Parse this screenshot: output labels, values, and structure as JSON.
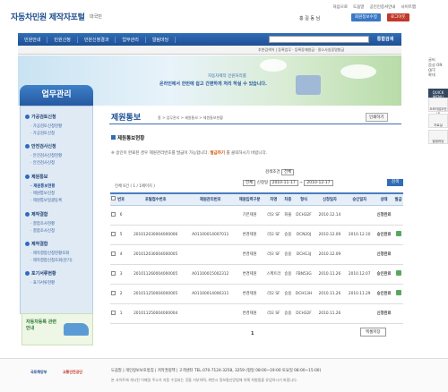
{
  "header": {
    "logo": "자동차민원 제작자포털",
    "logo_sub": "대국민",
    "util": [
      "처음으로",
      "도움말",
      "공인인증서안내",
      "사이트맵"
    ],
    "greeting": "홍 길 동 님",
    "edit_btn": "회원정보수정",
    "logout_btn": "로그아웃"
  },
  "nav": {
    "items": [
      "민원안내",
      "민원신청",
      "민원신청결과",
      "업무관리",
      "알림마당"
    ],
    "search_btn": "통합검색"
  },
  "subbar": {
    "text": "추천검색어 | 등록업무 · 등록증재발급 · 말소사실증명발급"
  },
  "banner": {
    "line1": "자동차제작 민원처리를",
    "line2": "온라인에서 한번에 쉽고 간편하게 처리 하실 수 있습니다."
  },
  "sidebar": {
    "title": "업무관리",
    "sections": [
      {
        "label": "가공검토신청",
        "items": [
          "가공검토신청현황",
          "가공검토신청"
        ]
      },
      {
        "label": "안전검사신청",
        "items": [
          "안전검사신청현황",
          "안전검사신청"
        ]
      },
      {
        "label": "제원통보",
        "items": [
          "제원통보현황",
          "제원통보신청",
          "제원통보일괄등록"
        ]
      },
      {
        "label": "제작결함",
        "items": [
          "결함조사현황",
          "결함조사신청"
        ]
      },
      {
        "label": "제작결합",
        "items": [
          "제작결합신청현황조회",
          "제작결합신청조회(분기)"
        ]
      },
      {
        "label": "포기서류현황",
        "items": [
          "표기서류현황"
        ]
      }
    ],
    "ad": "자동차등록 관련 안내"
  },
  "main": {
    "title": "제원통보",
    "crumb": "홈 > 업무관리 > 제원통보 > 제원통보현황",
    "print": "인쇄하기",
    "subtitle": "제원통보현황",
    "notice_pre": "※ 승인이 완료된 경우 제원관리번호를 발급이 가능합니다.",
    "notice_em": "발급하기",
    "notice_post": "를 클릭하시기 바랍니다.",
    "filter_label": "검색조건",
    "filter_value": "전체",
    "filter_status": "전체",
    "date_label": "신청일",
    "date_from": "2010-11-17",
    "date_to": "2010-12-17",
    "search": "검색",
    "count": "전체 6건 ( 1 / 1페이지 )",
    "columns": [
      "번호",
      "포털접수번호",
      "제원관리번호",
      "제원입력구분",
      "차명",
      "차종",
      "형식",
      "신청일자",
      "승인일자",
      "상태",
      "발급"
    ],
    "rows": [
      {
        "no": "6",
        "portal": "",
        "spec": "",
        "type": "기본제원",
        "car": "리오 SF",
        "kind": "화물",
        "form": "DCH32F",
        "req": "2010.12.14",
        "ok": "",
        "status": "신청완료",
        "issue": false
      },
      {
        "no": "5",
        "portal": "201012030004000006",
        "spec": "A01100014007011",
        "type": "변경제원",
        "car": "리오 SF",
        "kind": "승용",
        "form": "DCN20J",
        "req": "2010.12.09",
        "ok": "2010.12.10",
        "status": "승인완료",
        "issue": true
      },
      {
        "no": "4",
        "portal": "201012030004000005",
        "spec": "",
        "type": "변경제원",
        "car": "리오 SF",
        "kind": "승용",
        "form": "DCH13J",
        "req": "2010.12.09",
        "ok": "",
        "status": "신청완료",
        "issue": false
      },
      {
        "no": "3",
        "portal": "201011260004000005",
        "spec": "A01100015002312",
        "type": "변경제원",
        "car": "스펙트라",
        "kind": "승용",
        "form": "FBN53G",
        "req": "2010.11.26",
        "ok": "2010.12.07",
        "status": "승인완료",
        "issue": true
      },
      {
        "no": "2",
        "portal": "201011250004000005",
        "spec": "A01100014006311",
        "type": "변경제원",
        "car": "리오 SF",
        "kind": "승용",
        "form": "DCH13H",
        "req": "2010.11.26",
        "ok": "2010.11.29",
        "status": "승인완료",
        "issue": true
      },
      {
        "no": "1",
        "portal": "201011250004000004",
        "spec": "",
        "type": "변경제원",
        "car": "리오 SF",
        "kind": "승용",
        "form": "DCH32F",
        "req": "2010.11.26",
        "ok": "",
        "status": "신청완료",
        "issue": false
      }
    ],
    "pager": "1",
    "excel": "엑셀저장"
  },
  "footer": {
    "links": "도움말 | 개인정보보호방침 | 저작권정책 | 고객센터 TEL.070-7124-3258, 3259 (평일 08:00~19:00 토요일 08:00~15:00)",
    "copy": "본 사이트에 게시된 이메일 주소가 자동 수집되는 것을 거부하며, 위반시 정보통신망법에 의해 처벌됨을 유념하시기 바랍니다.",
    "logo1": "국토해양부",
    "logo2": "교통안전공단"
  },
  "right": {
    "top": "글씨",
    "zoom": "확대",
    "sound": "음성 ON OFF",
    "quick": "QUICK MENU",
    "items": [
      "초보자업무안내",
      "자료실",
      "알림마당"
    ]
  }
}
